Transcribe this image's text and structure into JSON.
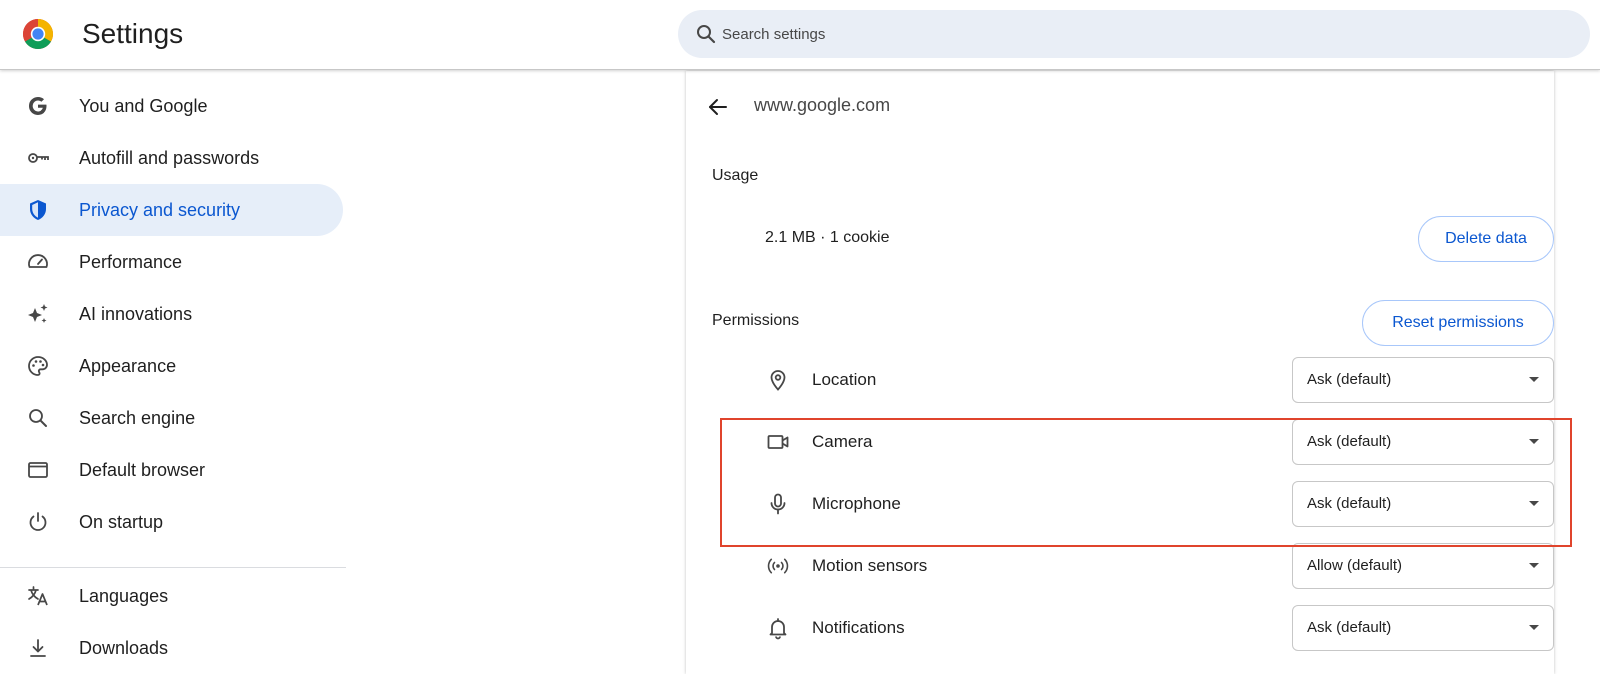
{
  "header": {
    "app_title": "Settings",
    "logo_icon": "chrome-logo-icon",
    "search": {
      "placeholder": "Search settings",
      "icon": "search-icon"
    }
  },
  "sidebar": {
    "items": [
      {
        "label": "You and Google",
        "icon": "google-g-icon",
        "active": false
      },
      {
        "label": "Autofill and passwords",
        "icon": "key-icon",
        "active": false
      },
      {
        "label": "Privacy and security",
        "icon": "shield-icon",
        "active": true
      },
      {
        "label": "Performance",
        "icon": "speedometer-icon",
        "active": false
      },
      {
        "label": "AI innovations",
        "icon": "sparkle-icon",
        "active": false
      },
      {
        "label": "Appearance",
        "icon": "palette-icon",
        "active": false
      },
      {
        "label": "Search engine",
        "icon": "search-icon",
        "active": false
      },
      {
        "label": "Default browser",
        "icon": "browser-window-icon",
        "active": false
      },
      {
        "label": "On startup",
        "icon": "power-icon",
        "active": false
      },
      {
        "label": "Languages",
        "icon": "translate-icon",
        "active": false
      },
      {
        "label": "Downloads",
        "icon": "download-icon",
        "active": false
      }
    ]
  },
  "main": {
    "site": "www.google.com",
    "back_icon": "arrow-back-icon",
    "usage": {
      "title": "Usage",
      "value": "2.1 MB · 1 cookie",
      "delete_label": "Delete data"
    },
    "permissions": {
      "title": "Permissions",
      "reset_label": "Reset permissions",
      "items": [
        {
          "label": "Location",
          "icon": "location-pin-icon",
          "value": "Ask (default)"
        },
        {
          "label": "Camera",
          "icon": "camera-icon",
          "value": "Ask (default)"
        },
        {
          "label": "Microphone",
          "icon": "microphone-icon",
          "value": "Ask (default)"
        },
        {
          "label": "Motion sensors",
          "icon": "motion-sensors-icon",
          "value": "Allow (default)"
        },
        {
          "label": "Notifications",
          "icon": "bell-icon",
          "value": "Ask (default)"
        }
      ]
    }
  },
  "annotation": {
    "color": "#e0442c",
    "highlighted_items": [
      "Camera",
      "Microphone"
    ]
  },
  "colors": {
    "accent": "#0b57d0",
    "active_nav_bg": "#e6eef9",
    "search_bg": "#e9eef6"
  }
}
